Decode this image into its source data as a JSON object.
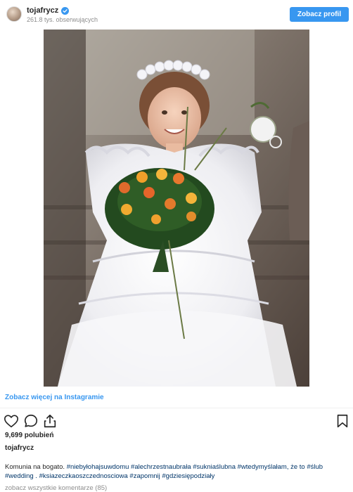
{
  "post": {
    "username": "tojafrycz",
    "followers": "261.8 tys. obserwujących",
    "profile_button": "Zobacz profil",
    "more_link": "Zobacz więcej na Instagramie",
    "likes": "9,699 polubień",
    "caption_user": "tojafrycz",
    "caption_text": "Komunia na bogato. ",
    "caption_tags": "#niebyłohajsuwdomu #alechrzestnaubrała #sukniaślubna #wtedymyślałam, że to #ślub #wedding . #ksiazeczkaoszczednosciowa #zapomnij #gdziesiępodziały",
    "comments_link": "zobacz wszystkie komentarze (85)"
  },
  "icons": {
    "verified": "verified-badge-icon",
    "like": "heart-icon",
    "comment": "comment-icon",
    "share": "share-icon",
    "save": "bookmark-icon"
  },
  "colors": {
    "accent": "#3897f0",
    "text": "#262626",
    "muted": "#8e8e8e",
    "hashtag": "#003569"
  }
}
